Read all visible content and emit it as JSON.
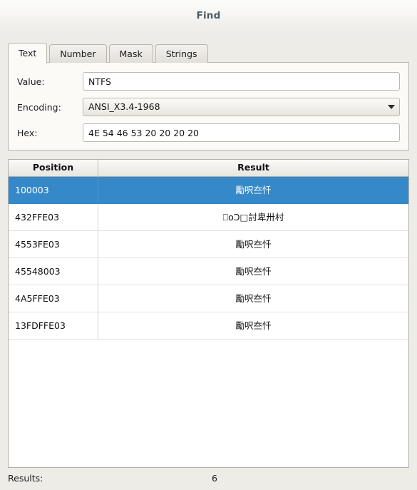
{
  "window": {
    "title": "Find"
  },
  "tabs": [
    {
      "label": "Text",
      "active": true
    },
    {
      "label": "Number",
      "active": false
    },
    {
      "label": "Mask",
      "active": false
    },
    {
      "label": "Strings",
      "active": false
    }
  ],
  "form": {
    "value": {
      "label": "Value:",
      "value": "NTFS",
      "placeholder": ""
    },
    "encoding": {
      "label": "Encoding:",
      "selected": "ANSI_X3.4-1968",
      "arrow_icon": "chevron-down-icon"
    },
    "hex": {
      "label": "Hex:",
      "value": "4E 54 46 53 20 20 20 20",
      "placeholder": ""
    }
  },
  "results_table": {
    "columns": [
      "Position",
      "Result"
    ],
    "selected_row_index": 0,
    "rows": [
      {
        "position": "100003",
        "result": "勵呎夳忏"
      },
      {
        "position": "432FFE03",
        "result": "⎕οƆ□討卑卅村"
      },
      {
        "position": "4553FE03",
        "result": "勵呎夳忏"
      },
      {
        "position": "45548003",
        "result": "勵呎夳忏"
      },
      {
        "position": "4A5FFE03",
        "result": "勵呎夳忏"
      },
      {
        "position": "13FDFFE03",
        "result": "勵呎夳忏"
      }
    ]
  },
  "statusbar": {
    "label": "Results:",
    "count": "6"
  },
  "colors": {
    "selection": "#3689c9",
    "title": "#4b5d66",
    "window_bg": "#eeece7",
    "panel_bg": "#fbfaf7"
  }
}
